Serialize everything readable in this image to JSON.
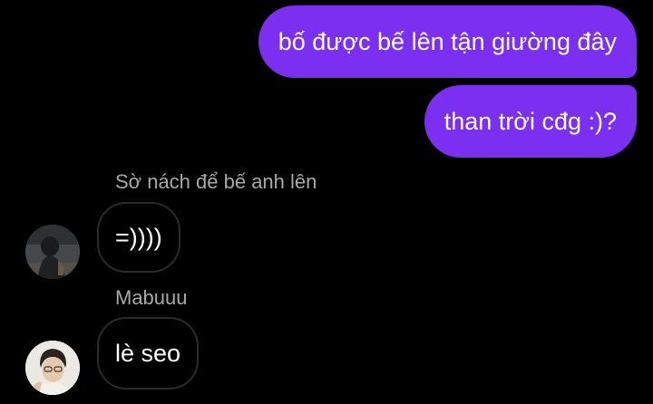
{
  "conversation": {
    "messages_out": [
      {
        "text": "bố được bế lên tận giường đây"
      },
      {
        "text": "than trời cđg :)?"
      }
    ],
    "messages_in": [
      {
        "sender": "Sờ nách để bế anh lên",
        "text": "=))))",
        "avatar_icon": "profile-photo-icon"
      },
      {
        "sender": "Mabuuu",
        "text": "lè seo",
        "avatar_icon": "profile-photo-icon"
      }
    ]
  },
  "colors": {
    "background": "#000000",
    "outgoing_bubble": "#7b2ff0",
    "incoming_border": "#2b2b2b",
    "sender_text": "#a8a8a8",
    "message_text": "#ffffff"
  }
}
